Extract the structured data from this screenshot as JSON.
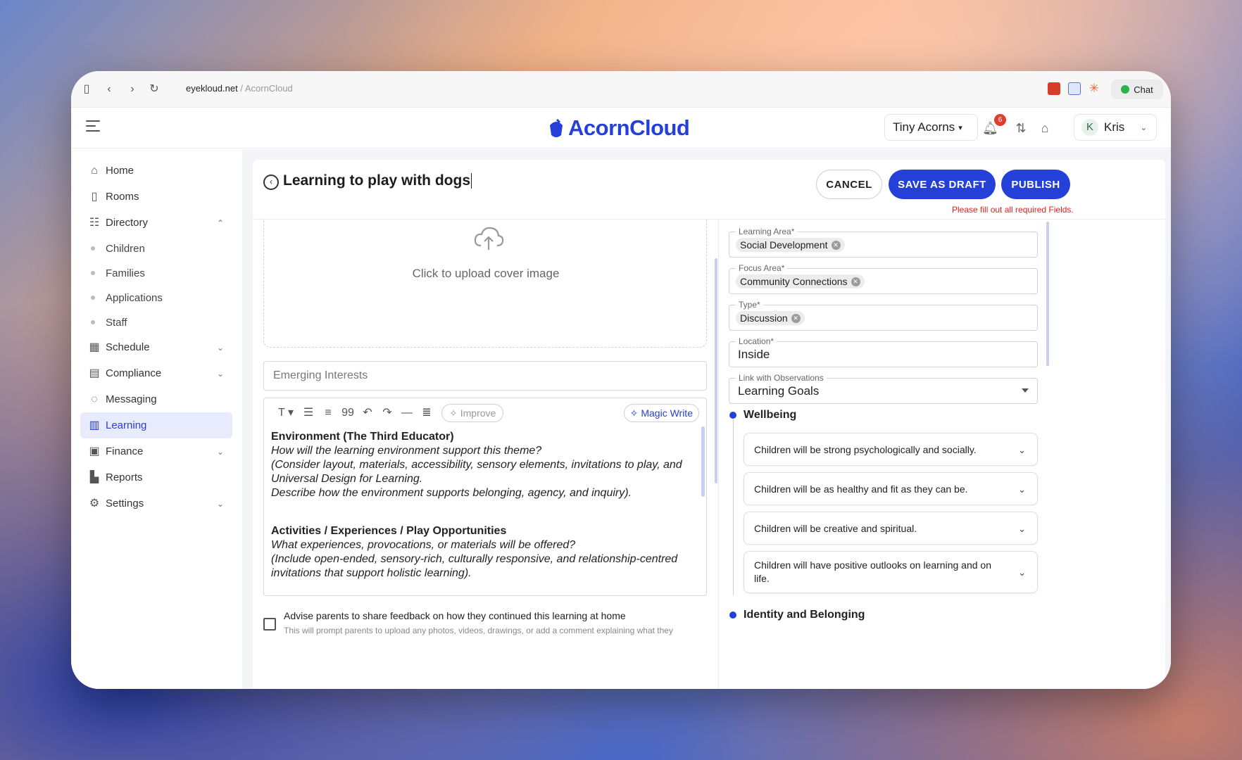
{
  "browser": {
    "url_domain": "eyekloud.net",
    "url_separator": " / ",
    "url_path": "AcornCloud",
    "chat_label": "Chat"
  },
  "header": {
    "logo_text": "AcornCloud",
    "org_select": "Tiny Acorns",
    "notification_count": "6",
    "user_initial": "K",
    "user_name": "Kris"
  },
  "sidebar": {
    "items": [
      {
        "label": "Home",
        "icon": "home-icon"
      },
      {
        "label": "Rooms",
        "icon": "door-icon"
      },
      {
        "label": "Directory",
        "icon": "people-icon"
      },
      {
        "label": "Schedule",
        "icon": "calendar-icon"
      },
      {
        "label": "Compliance",
        "icon": "calendar-check-icon"
      },
      {
        "label": "Messaging",
        "icon": "message-icon"
      },
      {
        "label": "Learning",
        "icon": "book-icon"
      },
      {
        "label": "Finance",
        "icon": "receipt-icon"
      },
      {
        "label": "Reports",
        "icon": "chart-icon"
      },
      {
        "label": "Settings",
        "icon": "gear-icon"
      }
    ],
    "directory_sub": [
      "Children",
      "Families",
      "Applications",
      "Staff"
    ],
    "active": "Learning"
  },
  "page": {
    "title": "Learning to play with dogs",
    "cancel": "CANCEL",
    "save_draft": "SAVE AS DRAFT",
    "publish": "PUBLISH",
    "required_msg": "Please fill out all required Fields."
  },
  "upload": {
    "text": "Click to upload cover image"
  },
  "emerging": {
    "placeholder": "Emerging Interests"
  },
  "editor": {
    "improve": "Improve",
    "magic_write": "Magic Write",
    "heading1": "Environment (The Third Educator)",
    "lines1": [
      "How will the learning environment support this theme?",
      "(Consider layout, materials, accessibility, sensory elements, invitations to play, and",
      "Universal Design for Learning.",
      "Describe how the environment supports belonging, agency, and inquiry)."
    ],
    "heading2": "Activities / Experiences / Play Opportunities",
    "lines2": [
      "What experiences, provocations, or materials will be offered?",
      "(Include open-ended, sensory-rich, culturally responsive, and relationship-centred",
      "invitations that support holistic learning)."
    ]
  },
  "feedback": {
    "label": "Advise parents to share feedback on how they continued this learning at home",
    "help": "This will prompt parents to upload any photos, videos, drawings, or add a comment explaining what they"
  },
  "fields": {
    "learning_area_label": "Learning Area*",
    "learning_area_value": "Social Development",
    "focus_area_label": "Focus Area*",
    "focus_area_value": "Community Connections",
    "type_label": "Type*",
    "type_value": "Discussion",
    "location_label": "Location*",
    "location_value": "Inside",
    "link_label": "Link with Observations",
    "link_value": "Learning Goals"
  },
  "sections": {
    "wellbeing": "Wellbeing",
    "wellbeing_items": [
      "Children will be strong psychologically and socially.",
      "Children will be as healthy and fit as they can be.",
      "Children will be creative and spiritual.",
      "Children will have positive outlooks on learning and on life."
    ],
    "identity": "Identity and Belonging"
  },
  "colors": {
    "accent": "#2540d9",
    "error": "#dd2222",
    "badge": "#e23b2f"
  }
}
